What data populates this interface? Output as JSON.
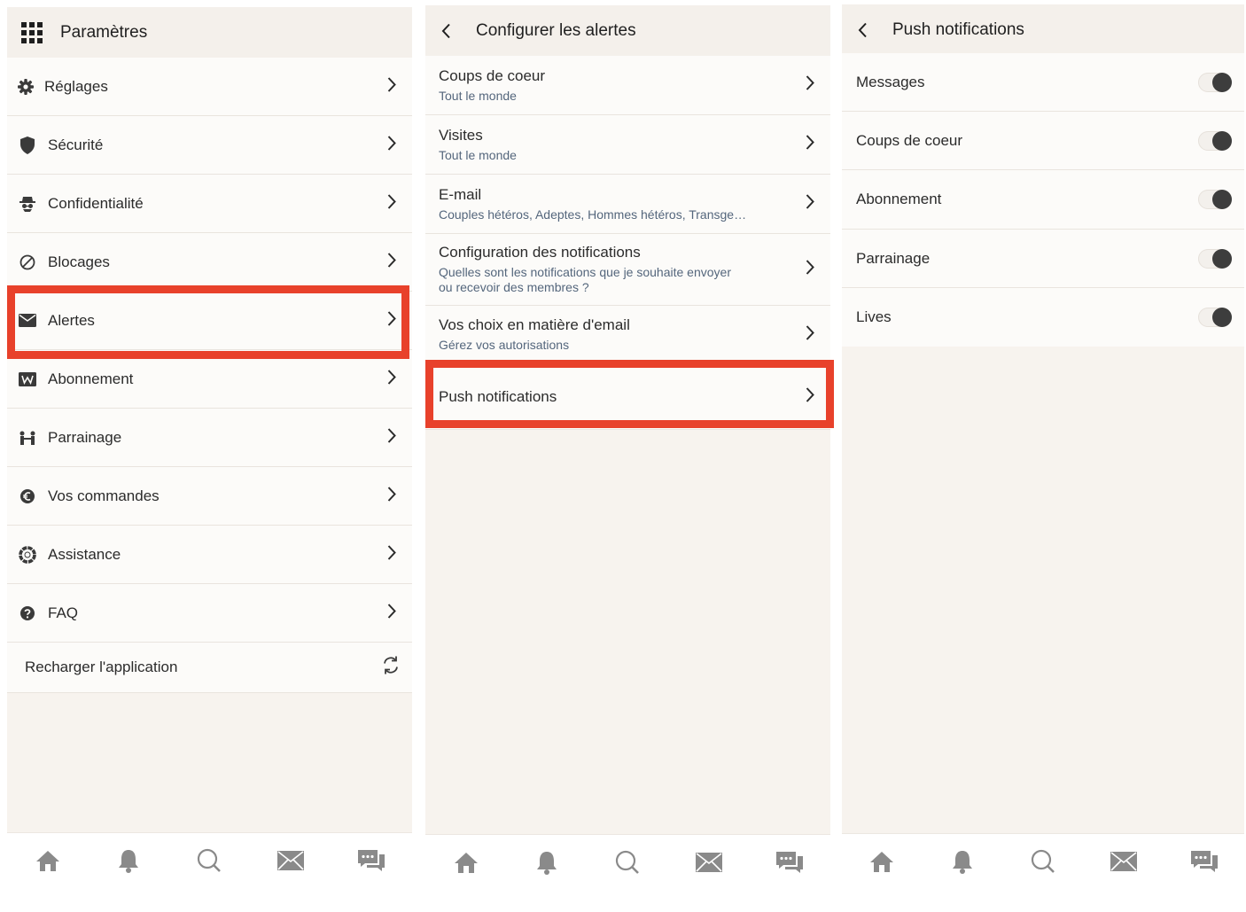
{
  "panel1": {
    "title": "Paramètres",
    "items": [
      {
        "label": "Réglages"
      },
      {
        "label": "Sécurité"
      },
      {
        "label": "Confidentialité"
      },
      {
        "label": "Blocages"
      },
      {
        "label": "Alertes"
      },
      {
        "label": "Abonnement"
      },
      {
        "label": "Parrainage"
      },
      {
        "label": "Vos commandes"
      },
      {
        "label": "Assistance"
      },
      {
        "label": "FAQ"
      }
    ],
    "reload_label": "Recharger l'application"
  },
  "panel2": {
    "title": "Configurer les alertes",
    "items": [
      {
        "label": "Coups de coeur",
        "sub": "Tout le monde"
      },
      {
        "label": "Visites",
        "sub": "Tout le monde"
      },
      {
        "label": "E-mail",
        "sub": "Couples hétéros, Adeptes, Hommes hétéros, Transge…"
      },
      {
        "label": "Configuration des notifications",
        "sub": "Quelles sont les notifications que je souhaite envoyer",
        "sub2": "ou recevoir des membres ?"
      },
      {
        "label": "Vos choix en matière d'email",
        "sub": "Gérez vos autorisations"
      },
      {
        "label": "Push notifications"
      }
    ]
  },
  "panel3": {
    "title": "Push notifications",
    "items": [
      {
        "label": "Messages",
        "enabled": false
      },
      {
        "label": "Coups de coeur",
        "enabled": false
      },
      {
        "label": "Abonnement",
        "enabled": false
      },
      {
        "label": "Parrainage",
        "enabled": false
      },
      {
        "label": "Lives",
        "enabled": false
      }
    ]
  },
  "tabbar": [
    "home-icon",
    "bell-icon",
    "search-icon",
    "mail-icon",
    "chat-icon"
  ],
  "colors": {
    "highlight": "#e8412b",
    "subtext": "#54667c",
    "icon": "#8a8a8a"
  }
}
